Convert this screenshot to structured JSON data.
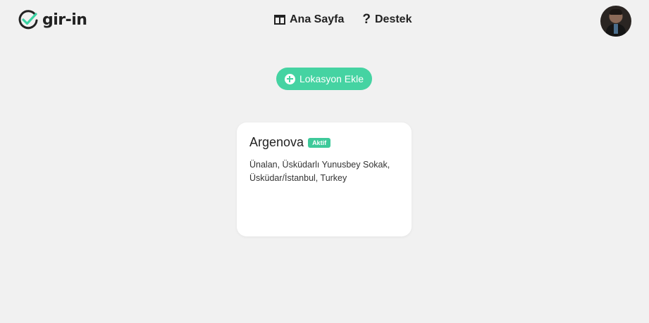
{
  "brand": {
    "logo_text": "gir-in",
    "accent_color": "#45d3a2"
  },
  "nav": {
    "items": [
      {
        "label": "Ana Sayfa",
        "icon": "columns-icon"
      },
      {
        "label": "Destek",
        "icon": "question-icon"
      }
    ]
  },
  "user": {
    "avatar": "user-avatar"
  },
  "actions": {
    "add_location_label": "Lokasyon Ekle"
  },
  "locations": [
    {
      "name": "Argenova",
      "status": "Aktif",
      "address_line1": "Ünalan, Üsküdarlı Yunusbey Sokak,",
      "address_line2": "Üsküdar/İstanbul, Turkey"
    }
  ]
}
